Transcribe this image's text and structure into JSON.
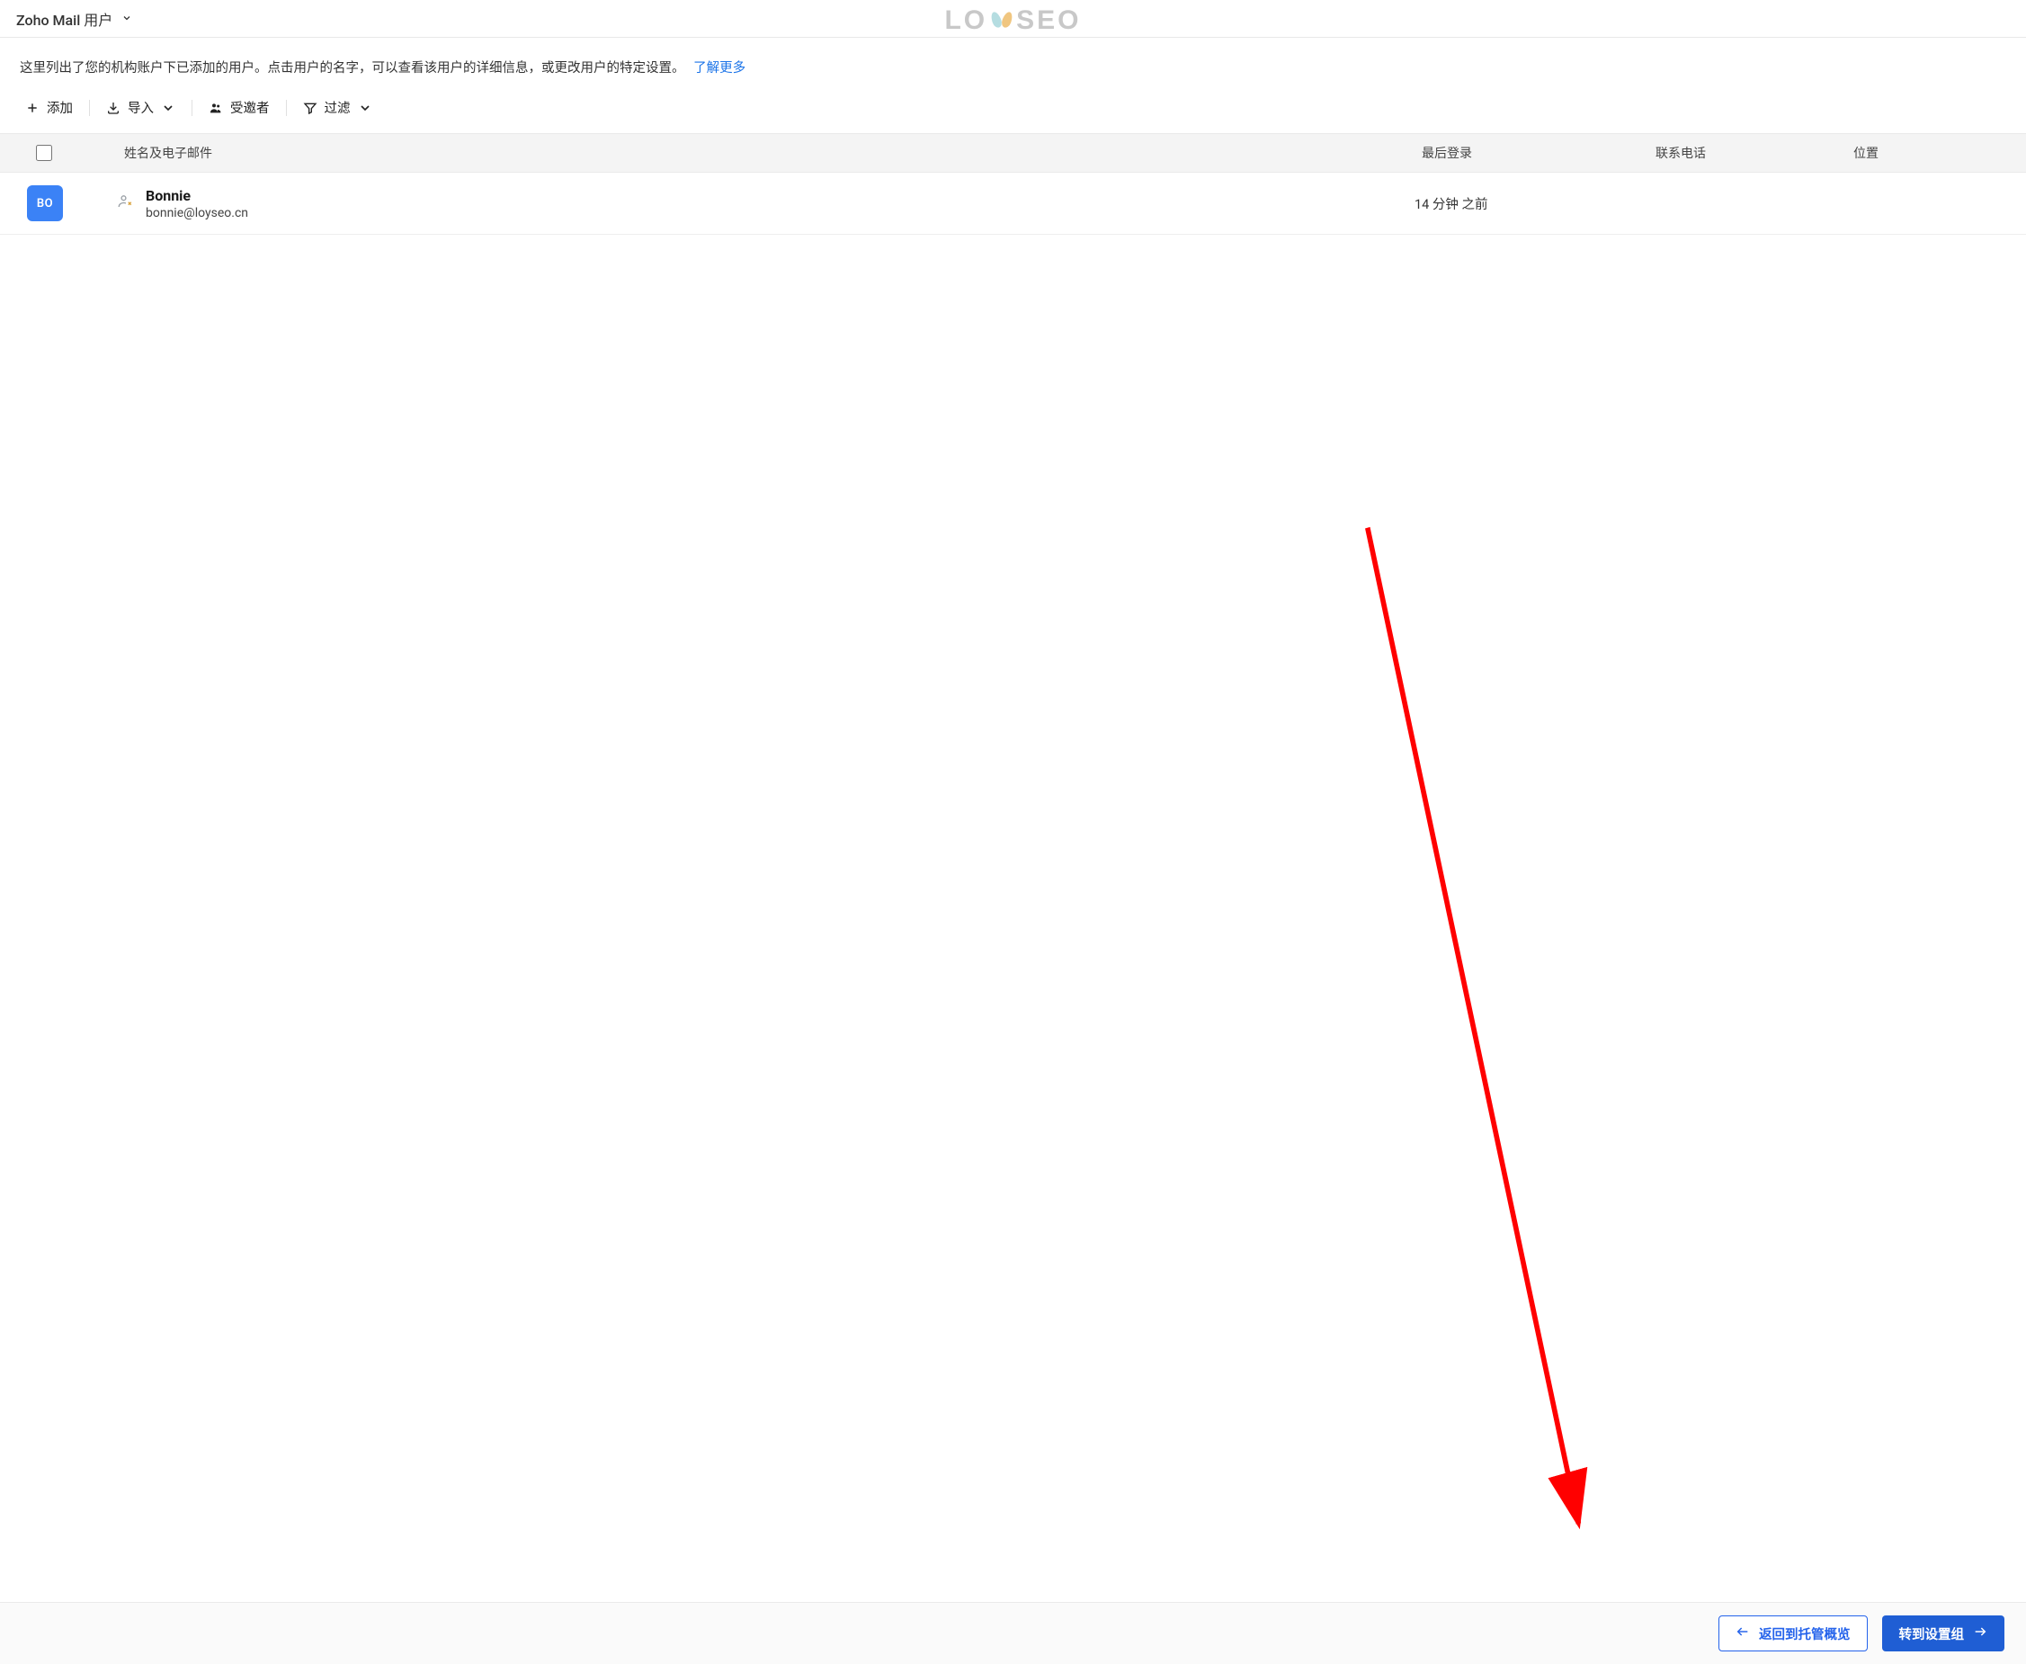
{
  "header": {
    "title": "Zoho Mail 用户"
  },
  "watermark": {
    "part1": "LO",
    "part2": "SEO"
  },
  "intro": {
    "text": "这里列出了您的机构账户下已添加的用户。点击用户的名字，可以查看该用户的详细信息，或更改用户的特定设置。",
    "learn_more": "了解更多"
  },
  "toolbar": {
    "add": "添加",
    "import": "导入",
    "invitee": "受邀者",
    "filter": "过滤"
  },
  "table": {
    "headers": {
      "name_email": "姓名及电子邮件",
      "last_login": "最后登录",
      "phone": "联系电话",
      "location": "位置"
    },
    "rows": [
      {
        "avatar_text": "BO",
        "name": "Bonnie",
        "email": "bonnie@loyseo.cn",
        "last_login": "14 分钟 之前",
        "phone": "",
        "location": ""
      }
    ]
  },
  "footer": {
    "back": "返回到托管概览",
    "next": "转到设置组"
  },
  "colors": {
    "primary": "#1f5ed4",
    "link": "#1a73e8",
    "avatar": "#3b82f6",
    "arrow": "#ff0000"
  }
}
